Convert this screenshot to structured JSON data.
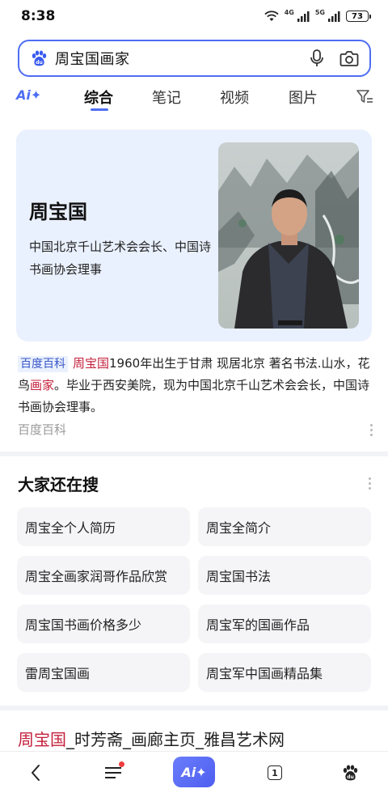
{
  "status_bar": {
    "time": "8:38",
    "network_1": "4G",
    "network_2": "5G",
    "battery": "73"
  },
  "search": {
    "query": "周宝国画家",
    "logo_icon": "baidu-paw-icon",
    "voice_icon": "microphone-icon",
    "camera_icon": "camera-icon"
  },
  "tabs": {
    "ai_label": "Ai✦",
    "items": [
      {
        "label": "综合"
      },
      {
        "label": "笔记"
      },
      {
        "label": "视频"
      },
      {
        "label": "图片"
      }
    ],
    "active_index": 0,
    "accent_color": "#4e6ef2"
  },
  "knowledge_card": {
    "title": "周宝国",
    "description": "中国北京千山艺术会会长、中国诗书画协会理事",
    "background_color": "#eaf1fe"
  },
  "summary": {
    "tag": "百度百科",
    "name_highlight": "周宝国",
    "text_part1": "1960年出生于甘肃 现居北京 著名书法.山水，花鸟",
    "highlight2": "画家",
    "text_part2": "。毕业于西安美院，现为中国北京千山艺术会会长，中国诗书画协会理事。",
    "source": "百度百科",
    "highlight_color": "#c4203b"
  },
  "related": {
    "title": "大家还在搜",
    "items": [
      "周宝全个人简历",
      "周宝全简介",
      "周宝全画家润哥作品欣赏",
      "周宝国书法",
      "周宝国书画价格多少",
      "周宝军的国画作品",
      "雷周宝国画",
      "周宝军中国画精品集"
    ]
  },
  "result": {
    "title_highlight": "周宝国",
    "title_rest": "_时芳斋_画廊主页_雅昌艺术网"
  },
  "bottom_nav": {
    "back_icon": "back-arrow-icon",
    "menu_icon": "menu-icon",
    "ai_label": "Ai✦",
    "tab_count": "1",
    "home_icon": "baidu-paw-icon"
  }
}
